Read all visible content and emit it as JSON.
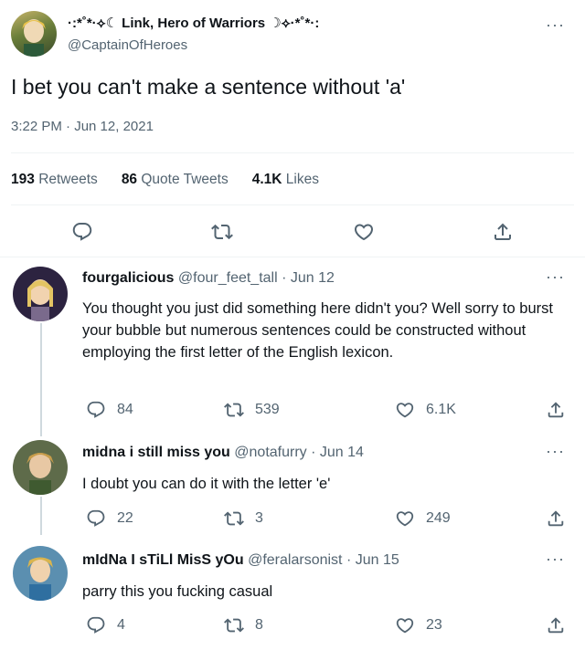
{
  "main_tweet": {
    "display_name": "·:*˚*·⟡☾ Link, Hero of Warriors ☽⟡·*˚*·:",
    "handle": "@CaptainOfHeroes",
    "text": "I bet you can't make a sentence without 'a'",
    "timestamp": "3:22 PM · Jun 12, 2021",
    "stats": {
      "retweets_count": "193",
      "retweets_label": "Retweets",
      "quotes_count": "86",
      "quotes_label": "Quote Tweets",
      "likes_count": "4.1K",
      "likes_label": "Likes"
    }
  },
  "replies": [
    {
      "display_name": "fourgalicious",
      "handle": "@four_feet_tall",
      "date": "· Jun 12",
      "text": "You thought you just did something here didn't you? Well sorry to burst your bubble but numerous sentences could be constructed without employing the first letter of the English lexicon.",
      "replies": "84",
      "retweets": "539",
      "likes": "6.1K"
    },
    {
      "display_name": "midna i still miss you",
      "handle": "@notafurry",
      "date": "· Jun 14",
      "text": "I doubt you can do it with the letter 'e'",
      "replies": "22",
      "retweets": "3",
      "likes": "249"
    },
    {
      "display_name": "mIdNa I sTiLl MisS yOu",
      "handle": "@feralarsonist",
      "date": "· Jun 15",
      "text": "parry this you fucking casual",
      "replies": "4",
      "retweets": "8",
      "likes": "23"
    }
  ],
  "more_glyph": "···",
  "icons": [
    "reply-icon",
    "retweet-icon",
    "like-icon",
    "share-icon",
    "more-icon"
  ],
  "colors": {
    "text": "#0f1419",
    "muted": "#536471",
    "line": "#cfd9de"
  }
}
